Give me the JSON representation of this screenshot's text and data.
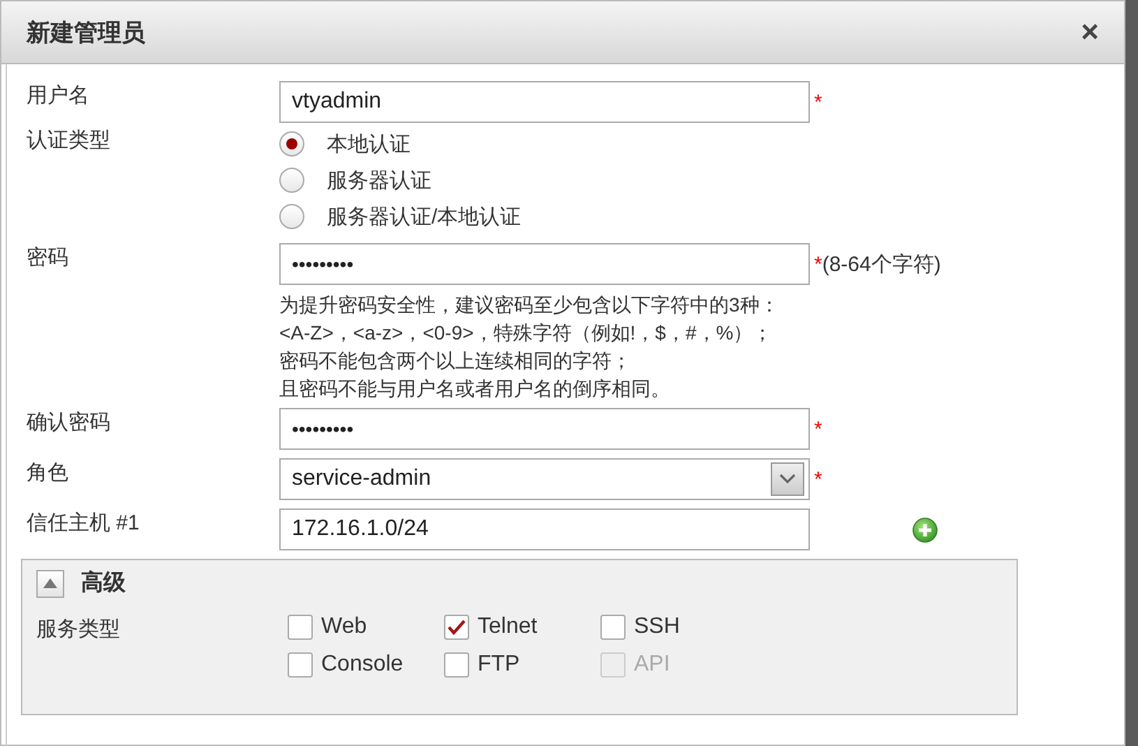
{
  "dialog": {
    "title": "新建管理员",
    "close": "×"
  },
  "fields": [
    {
      "kind": "text",
      "label": "用户名",
      "value": "vtyadmin",
      "required_mark": "*"
    },
    {
      "kind": "radio",
      "label": "认证类型",
      "options": [
        {
          "label": "本地认证",
          "selected": true
        },
        {
          "label": "服务器认证",
          "selected": false
        },
        {
          "label": "服务器认证/本地认证",
          "selected": false
        }
      ]
    },
    {
      "kind": "password",
      "label": "密码",
      "value": "•••••••••",
      "required_mark": "*",
      "note": "(8-64个字符)",
      "hint": [
        "为提升密码安全性，建议密码至少包含以下字符中的3种：",
        "<A-Z>，<a-z>，<0-9>，特殊字符（例如!，$，#，%）；",
        "密码不能包含两个以上连续相同的字符；",
        "且密码不能与用户名或者用户名的倒序相同。"
      ]
    },
    {
      "kind": "password",
      "label": "确认密码",
      "value": "•••••••••",
      "required_mark": "*"
    },
    {
      "kind": "select",
      "label": "角色",
      "value": "service-admin",
      "required_mark": "*"
    },
    {
      "kind": "host",
      "label": "信任主机 #1",
      "value": "172.16.1.0/24"
    }
  ],
  "advanced": {
    "title": "高级",
    "expanded": true,
    "label": "服务类型",
    "services": [
      {
        "label": "Web",
        "checked": false,
        "disabled": false
      },
      {
        "label": "Telnet",
        "checked": true,
        "disabled": false
      },
      {
        "label": "SSH",
        "checked": false,
        "disabled": false
      },
      {
        "label": "Console",
        "checked": false,
        "disabled": false
      },
      {
        "label": "FTP",
        "checked": false,
        "disabled": false
      },
      {
        "label": "API",
        "checked": false,
        "disabled": true
      }
    ]
  }
}
